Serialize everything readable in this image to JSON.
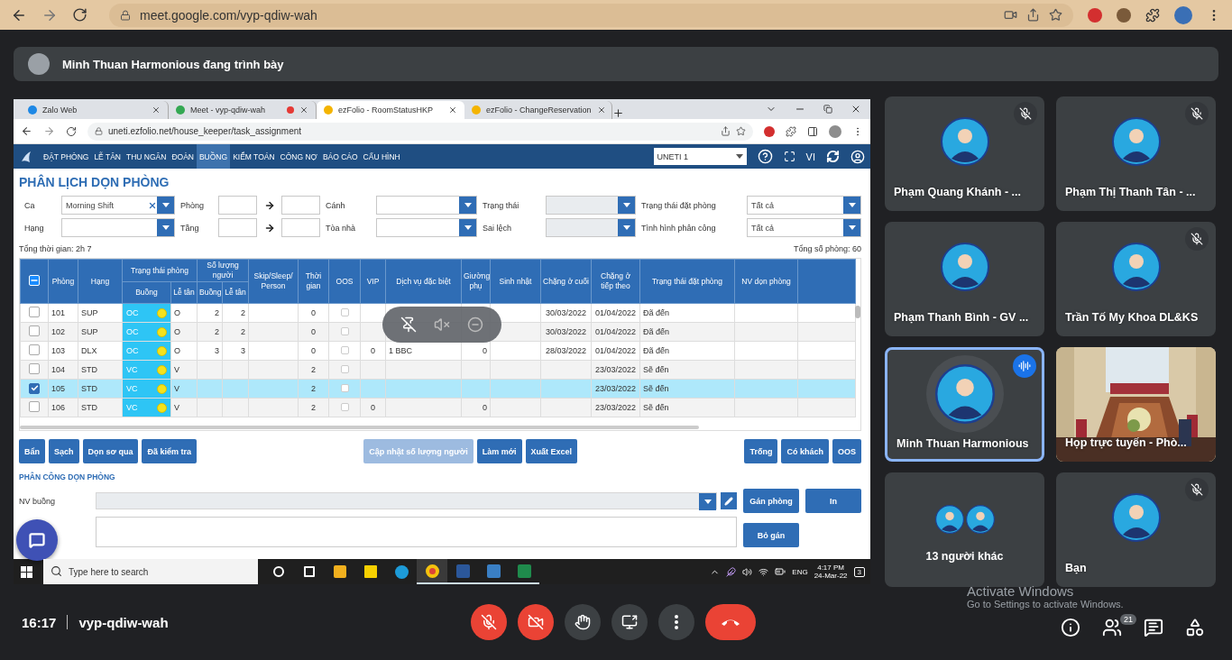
{
  "browser": {
    "url": "meet.google.com/vyp-qdiw-wah"
  },
  "presenter_bar": {
    "text": "Minh Thuan Harmonious đang trình bày"
  },
  "shared_screen": {
    "tabs": [
      {
        "title": "Zalo Web",
        "selected": false,
        "recording": false
      },
      {
        "title": "Meet - vyp-qdiw-wah",
        "selected": false,
        "recording": true
      },
      {
        "title": "ezFolio - RoomStatusHKP",
        "selected": true,
        "recording": false
      },
      {
        "title": "ezFolio - ChangeReservation",
        "selected": false,
        "recording": false
      }
    ],
    "url": "uneti.ezfolio.net/house_keeper/task_assignment",
    "nav": [
      {
        "label": "ĐẶT PHÒNG",
        "selected": false
      },
      {
        "label": "LỄ TÂN",
        "selected": false
      },
      {
        "label": "THU NGÂN",
        "selected": false
      },
      {
        "label": "ĐOÀN",
        "selected": false
      },
      {
        "label": "BUỒNG",
        "selected": true
      },
      {
        "label": "KIỂM TOÁN",
        "selected": false
      },
      {
        "label": "CÔNG NỢ",
        "selected": false
      },
      {
        "label": "BÁO CÁO",
        "selected": false
      },
      {
        "label": "CẤU HÌNH",
        "selected": false
      }
    ],
    "property_select": "UNETI 1",
    "language": "VI",
    "title": "PHÂN LỊCH DỌN PHÒNG",
    "filters": [
      [
        {
          "kind": "select",
          "label": "Ca",
          "value": "Morning Shift",
          "clearable": true,
          "disabled": false
        },
        {
          "kind": "range",
          "label": "Phòng"
        },
        {
          "kind": "select",
          "label": "Cánh",
          "clearable": false,
          "disabled": false
        },
        {
          "kind": "select",
          "label": "Trạng thái",
          "clearable": false,
          "disabled": true
        },
        {
          "kind": "select",
          "label": "Trạng thái đặt phòng",
          "value": "Tất cả",
          "clearable": false,
          "disabled": false
        }
      ],
      [
        {
          "kind": "select",
          "label": "Hạng",
          "clearable": false,
          "disabled": false
        },
        {
          "kind": "range",
          "label": "Tầng"
        },
        {
          "kind": "select",
          "label": "Tòa nhà",
          "clearable": false,
          "disabled": false
        },
        {
          "kind": "select",
          "label": "Sai lệch",
          "clearable": false,
          "disabled": true
        },
        {
          "kind": "select",
          "label": "Tình hình phân công",
          "value": "Tất cả",
          "clearable": false,
          "disabled": false
        }
      ]
    ],
    "total_time": "Tổng thời gian: 2h 7",
    "total_rooms": "Tổng số phòng: 60",
    "table": {
      "select_all_indeterminate": true,
      "columns": [
        {
          "label": "Phòng"
        },
        {
          "label": "Hạng"
        },
        {
          "label": "Trạng thái phòng",
          "sub": [
            "Buồng",
            "Lễ tân"
          ]
        },
        {
          "label": "Số lượng người",
          "sub": [
            "Buồng",
            "Lễ tân"
          ]
        },
        {
          "label": "Skip/Sleep/ Person"
        },
        {
          "label": "Thời gian"
        },
        {
          "label": "OOS"
        },
        {
          "label": "VIP"
        },
        {
          "label": "Dịch vụ đặc biệt"
        },
        {
          "label": "Giường phụ"
        },
        {
          "label": "Sinh nhật"
        },
        {
          "label": "Chặng ở cuối"
        },
        {
          "label": "Chặng ở tiếp theo"
        },
        {
          "label": "Trạng thái đặt phòng"
        },
        {
          "label": "NV dọn phòng"
        }
      ],
      "rows": [
        {
          "selected": false,
          "room": "101",
          "type": "SUP",
          "hk_status": "OC",
          "fo_status": "O",
          "hk_people": "2",
          "fo_people": "2",
          "time": "0",
          "oos": false,
          "last_stay": "30/03/2022",
          "next_stay": "01/04/2022",
          "booking_status": "Đã đến"
        },
        {
          "selected": false,
          "room": "102",
          "type": "SUP",
          "hk_status": "OC",
          "fo_status": "O",
          "hk_people": "2",
          "fo_people": "2",
          "time": "0",
          "oos": false,
          "last_stay": "30/03/2022",
          "next_stay": "01/04/2022",
          "booking_status": "Đã đến"
        },
        {
          "selected": false,
          "room": "103",
          "type": "DLX",
          "hk_status": "OC",
          "fo_status": "O",
          "hk_people": "3",
          "fo_people": "3",
          "time": "0",
          "oos": false,
          "vip": "0",
          "special": "1 BBC",
          "extra_bed": "0",
          "last_stay": "28/03/2022",
          "next_stay": "01/04/2022",
          "booking_status": "Đã đến"
        },
        {
          "selected": false,
          "room": "104",
          "type": "STD",
          "hk_status": "VC",
          "fo_status": "V",
          "time": "2",
          "oos": false,
          "next_stay": "23/03/2022",
          "booking_status": "Sẽ đến"
        },
        {
          "selected": true,
          "room": "105",
          "type": "STD",
          "hk_status": "VC",
          "fo_status": "V",
          "time": "2",
          "oos": false,
          "next_stay": "23/03/2022",
          "booking_status": "Sẽ đến"
        },
        {
          "selected": false,
          "room": "106",
          "type": "STD",
          "hk_status": "VC",
          "fo_status": "V",
          "time": "2",
          "oos": false,
          "vip": "0",
          "extra_bed": "0",
          "next_stay": "23/03/2022",
          "booking_status": "Sẽ đến"
        }
      ]
    },
    "actions": {
      "left": [
        {
          "label": "Bẩn",
          "disabled": false
        },
        {
          "label": "Sạch",
          "disabled": false
        },
        {
          "label": "Dọn sơ qua",
          "disabled": false
        },
        {
          "label": "Đã kiểm tra",
          "disabled": false
        }
      ],
      "center": [
        {
          "label": "Cập nhật số lượng người",
          "disabled": true
        },
        {
          "label": "Làm mới",
          "disabled": false
        },
        {
          "label": "Xuất Excel",
          "disabled": false
        }
      ],
      "right": [
        {
          "label": "Trống",
          "disabled": false
        },
        {
          "label": "Có khách",
          "disabled": false
        },
        {
          "label": "OOS",
          "disabled": false
        }
      ]
    },
    "assignment": {
      "title": "PHÂN CÔNG DỌN PHÒNG",
      "staff_label": "NV buồng",
      "staff_disabled": true,
      "assign_button": "Gán phòng",
      "print_button": "In",
      "unassign_button": "Bỏ gán"
    },
    "taskbar": {
      "search_placeholder": "Type here to search",
      "language": "ENG",
      "time": "4:17 PM",
      "date": "24-Mar-22",
      "notifications": "3"
    }
  },
  "participants": [
    {
      "kind": "avatar",
      "name": "Phạm Quang Khánh - ...",
      "muted": true,
      "speaking": false
    },
    {
      "kind": "avatar",
      "name": "Phạm Thị Thanh Tân - ...",
      "muted": true,
      "speaking": false
    },
    {
      "kind": "avatar",
      "name": "Phạm Thanh Bình - GV ...",
      "muted": false,
      "speaking": false
    },
    {
      "kind": "avatar",
      "name": "Trần Tố My Khoa DL&KS",
      "muted": true,
      "speaking": false
    },
    {
      "kind": "avatar",
      "name": "Minh Thuan Harmonious",
      "muted": false,
      "speaking": true
    },
    {
      "kind": "video",
      "name": "Họp trực tuyến - Phò...",
      "muted": false,
      "speaking": false
    },
    {
      "kind": "others",
      "name": "13 người khác",
      "muted": false,
      "speaking": false
    },
    {
      "kind": "avatar",
      "name": "Bạn",
      "muted": true,
      "speaking": false
    }
  ],
  "bottom_bar": {
    "time": "16:17",
    "meeting_code": "vyp-qdiw-wah",
    "controls": [
      {
        "kind": "mic",
        "on": false
      },
      {
        "kind": "camera",
        "on": false
      },
      {
        "kind": "hand"
      },
      {
        "kind": "present"
      },
      {
        "kind": "more"
      },
      {
        "kind": "leave"
      }
    ],
    "people_count": "21"
  },
  "windows_notice": {
    "title": "Activate Windows",
    "text": "Go to Settings to activate Windows."
  }
}
